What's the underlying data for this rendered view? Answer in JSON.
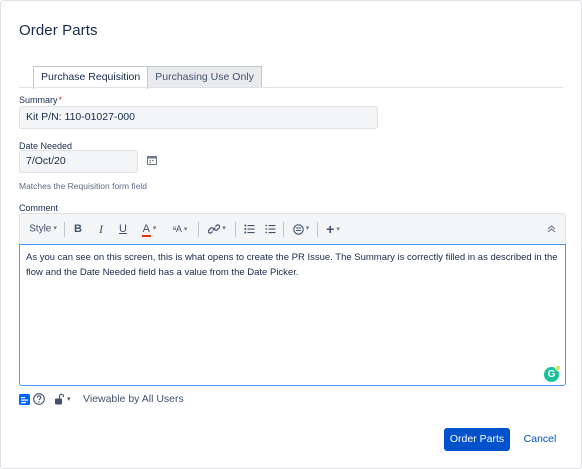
{
  "dialog": {
    "title": "Order Parts"
  },
  "tabs": [
    {
      "label": "Purchase Requisition",
      "active": true
    },
    {
      "label": "Purchasing Use Only",
      "active": false
    }
  ],
  "summary": {
    "label": "Summary",
    "required_marker": "*",
    "value": "Kit P/N: 110-01027-000"
  },
  "date_needed": {
    "label": "Date Needed",
    "value": "7/Oct/20",
    "hint": "Matches the Requisition form field"
  },
  "comment": {
    "label": "Comment",
    "toolbar": {
      "style_label": "Style",
      "bold": "B",
      "italic": "I",
      "underline": "U",
      "text_color": "A",
      "more_format": "ᵃA",
      "insert": "+"
    },
    "text": "As you can see on this screen, this is what opens to create the PR Issue. The Summary is correctly filled in as described in the flow and the Date Needed field has a value from the Date Picker."
  },
  "restriction": {
    "label": "Viewable by All Users"
  },
  "actions": {
    "submit": "Order Parts",
    "cancel": "Cancel"
  },
  "colors": {
    "primary": "#0052cc",
    "required": "#de350b",
    "focus_border": "#4c9aff"
  }
}
